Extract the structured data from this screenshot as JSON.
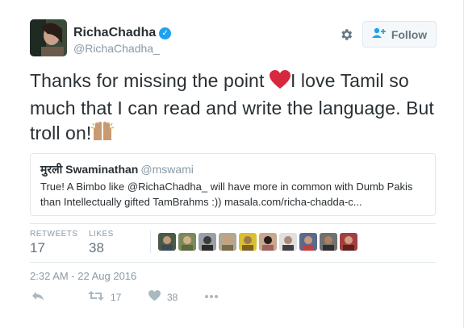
{
  "user": {
    "display_name": "RichaChadha",
    "handle": "@RichaChadha_",
    "verified": true
  },
  "follow": {
    "label": "Follow"
  },
  "tweet": {
    "text_part1": "Thanks for missing the point ",
    "text_part2": "I love Tamil so much that I can read and write the language. But troll on!",
    "emoji_1": "heart",
    "emoji_2": "raised-hands"
  },
  "quoted": {
    "name": "मुरली Swaminathan",
    "handle": "@mswami",
    "text": "True! A Bimbo like @RichaChadha_ will have more in common with Dumb Pakis than Intellectually gifted TamBrahms :)) masala.com/richa-chadda-c..."
  },
  "stats": {
    "retweets_label": "RETWEETS",
    "retweets": "17",
    "likes_label": "LIKES",
    "likes": "38"
  },
  "timestamp": "2:32 AM - 22 Aug 2016",
  "actions": {
    "retweet_count": "17",
    "like_count": "38"
  },
  "colors": {
    "accent": "#1da1f2",
    "muted": "#8899a6",
    "heart": "#e0245e"
  }
}
